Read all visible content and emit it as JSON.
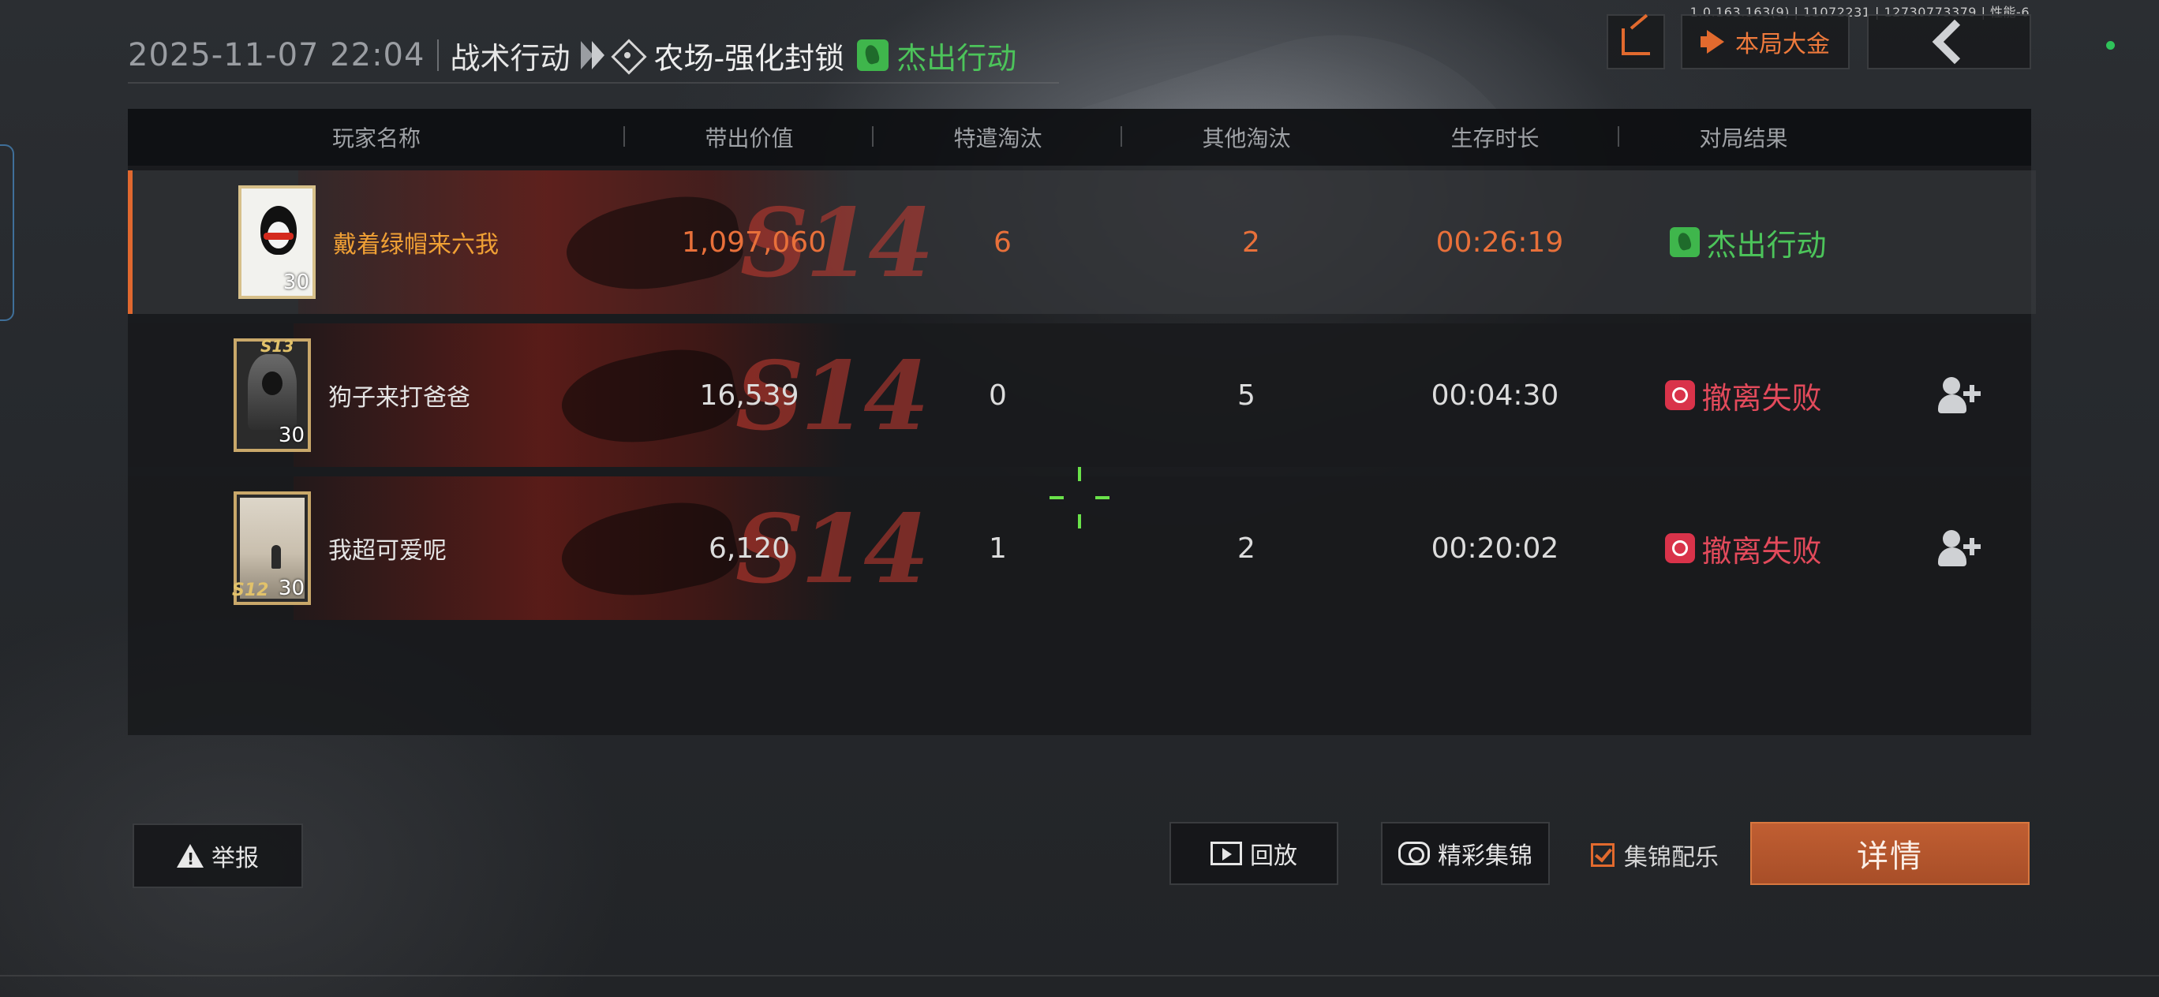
{
  "version_text": "1.0.163.163(9) | 11072231 | 12730773379 | 性能-6",
  "header": {
    "datetime": "2025-11-07 22:04",
    "mode": "战术行动",
    "map": "农场-强化封锁",
    "result": "杰出行动"
  },
  "top_buttons": {
    "share_icon": "share-icon",
    "jackpot_label": "本局大金",
    "back_icon": "chevron-left-icon"
  },
  "table": {
    "columns": [
      "玩家名称",
      "带出价值",
      "特遣淘汰",
      "其他淘汰",
      "生存时长",
      "对局结果"
    ],
    "rows": [
      {
        "name": "戴着绿帽来六我",
        "level": "30",
        "value": "1,097,060",
        "special_kills": "6",
        "other_kills": "2",
        "survival": "00:26:19",
        "result": "杰出行动",
        "result_type": "success",
        "is_self": true,
        "banner": "S14"
      },
      {
        "name": "狗子来打爸爸",
        "level": "30",
        "value": "16,539",
        "special_kills": "0",
        "other_kills": "5",
        "survival": "00:04:30",
        "result": "撤离失败",
        "result_type": "fail",
        "is_self": false,
        "banner": "S14",
        "avatar_badge": "S13"
      },
      {
        "name": "我超可爱呢",
        "level": "30",
        "value": "6,120",
        "special_kills": "1",
        "other_kills": "2",
        "survival": "00:20:02",
        "result": "撤离失败",
        "result_type": "fail",
        "is_self": false,
        "banner": "S14",
        "avatar_badge": "S12"
      }
    ]
  },
  "bottom": {
    "report_label": "举报",
    "replay_label": "回放",
    "highlight_label": "精彩集锦",
    "music_label": "集锦配乐",
    "music_checked": true,
    "details_label": "详情"
  },
  "colors": {
    "accent": "#e26a2e",
    "success": "#4cc45a",
    "fail": "#e24a5b",
    "self_name": "#f0a035"
  }
}
